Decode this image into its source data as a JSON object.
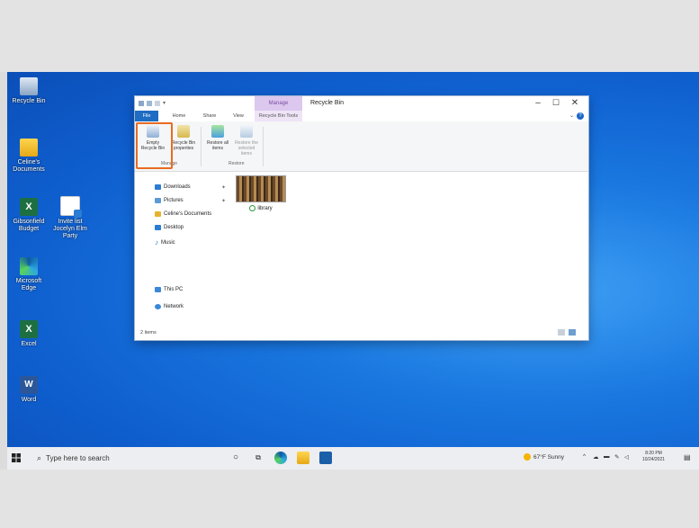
{
  "desktop": {
    "icons": [
      {
        "label": "Recycle Bin",
        "icon": "recycle-bin-icon"
      },
      {
        "label": "Celine's Documents",
        "icon": "folder-icon"
      },
      {
        "label": "Gibsonfield Budget",
        "icon": "excel-file-icon"
      },
      {
        "label": "Invite list Jocelyn Elm Party",
        "icon": "word-file-icon"
      },
      {
        "label": "Microsoft Edge",
        "icon": "edge-icon"
      },
      {
        "label": "Excel",
        "icon": "excel-icon"
      },
      {
        "label": "Word",
        "icon": "word-icon"
      }
    ]
  },
  "window": {
    "title": "Recycle Bin",
    "context_tab": "Manage",
    "menu_tabs": [
      "File",
      "Home",
      "Share",
      "View",
      "Recycle Bin Tools"
    ],
    "controls": {
      "minimize": "–",
      "maximize": "☐",
      "close": "✕"
    },
    "help": "?",
    "ribbon": {
      "buttons": [
        {
          "label": "Empty Recycle Bin",
          "icon": "empty-recycle-bin-icon"
        },
        {
          "label": "Recycle Bin properties",
          "icon": "properties-icon"
        },
        {
          "label": "Restore all items",
          "icon": "restore-all-icon"
        },
        {
          "label": "Restore the selected items",
          "icon": "restore-selected-icon"
        }
      ],
      "groups": [
        "Manage",
        "Restore"
      ]
    },
    "nav": [
      {
        "label": "Downloads",
        "icon": "downloads-icon",
        "color": "#2b7cd3",
        "pinned": true
      },
      {
        "label": "Pictures",
        "icon": "pictures-icon",
        "color": "#5a9bd5",
        "pinned": true
      },
      {
        "label": "Celine's Documents",
        "icon": "folder-icon",
        "color": "#e6b32e",
        "pinned": false
      },
      {
        "label": "Desktop",
        "icon": "desktop-icon",
        "color": "#2b7cd3",
        "pinned": false
      },
      {
        "label": "Music",
        "icon": "music-icon",
        "color": "#2b7cd3",
        "pinned": false
      },
      {
        "label": "This PC",
        "icon": "this-pc-icon",
        "color": "#3a88d8",
        "pinned": false
      },
      {
        "label": "Network",
        "icon": "network-icon",
        "color": "#3a88d8",
        "pinned": false
      }
    ],
    "files": [
      {
        "label": "library"
      }
    ],
    "status": {
      "count": "2 items"
    }
  },
  "taskbar": {
    "search_placeholder": "Type here to search",
    "weather": "67°F  Sunny",
    "time": "8:20 PM",
    "date": "10/24/2021"
  },
  "colors": {
    "highlight": "#ea6b23",
    "desktop": "#1a78e0",
    "accent": "#1f6cc3"
  }
}
